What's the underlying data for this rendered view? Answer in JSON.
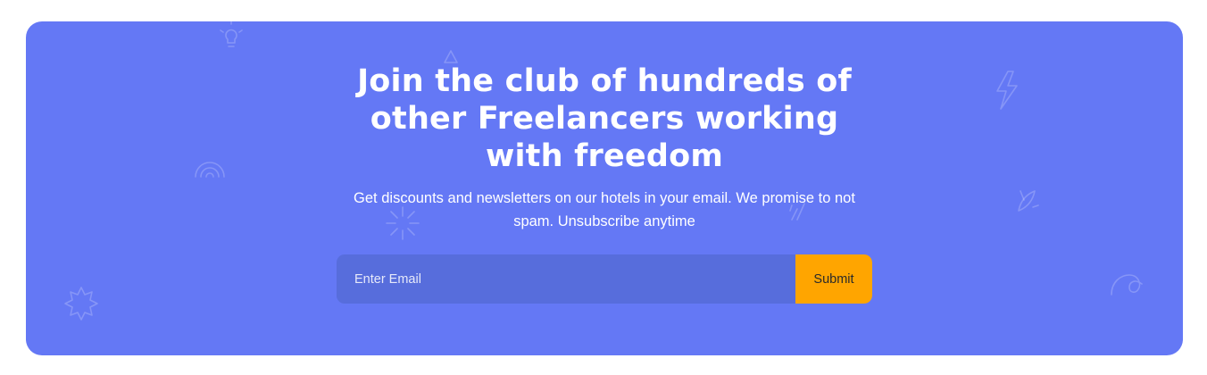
{
  "newsletter": {
    "headline": "Join the club of hundreds of other Freelancers working with freedom",
    "subtitle": "Get discounts and newsletters on our hotels in your email. We promise to not spam. Unsubscribe anytime",
    "email_placeholder": "Enter Email",
    "submit_label": "Submit"
  },
  "colors": {
    "banner_background": "#6478f5",
    "input_background": "#576ddc",
    "submit_background": "#ffa500",
    "text": "#ffffff"
  },
  "decorations": [
    "lightbulb-icon",
    "rainbow-icon",
    "starburst-icon",
    "sparkle-icon",
    "triangle-icon",
    "lightning-icon",
    "leaf-icon",
    "loop-icon",
    "spark-lines-icon"
  ]
}
